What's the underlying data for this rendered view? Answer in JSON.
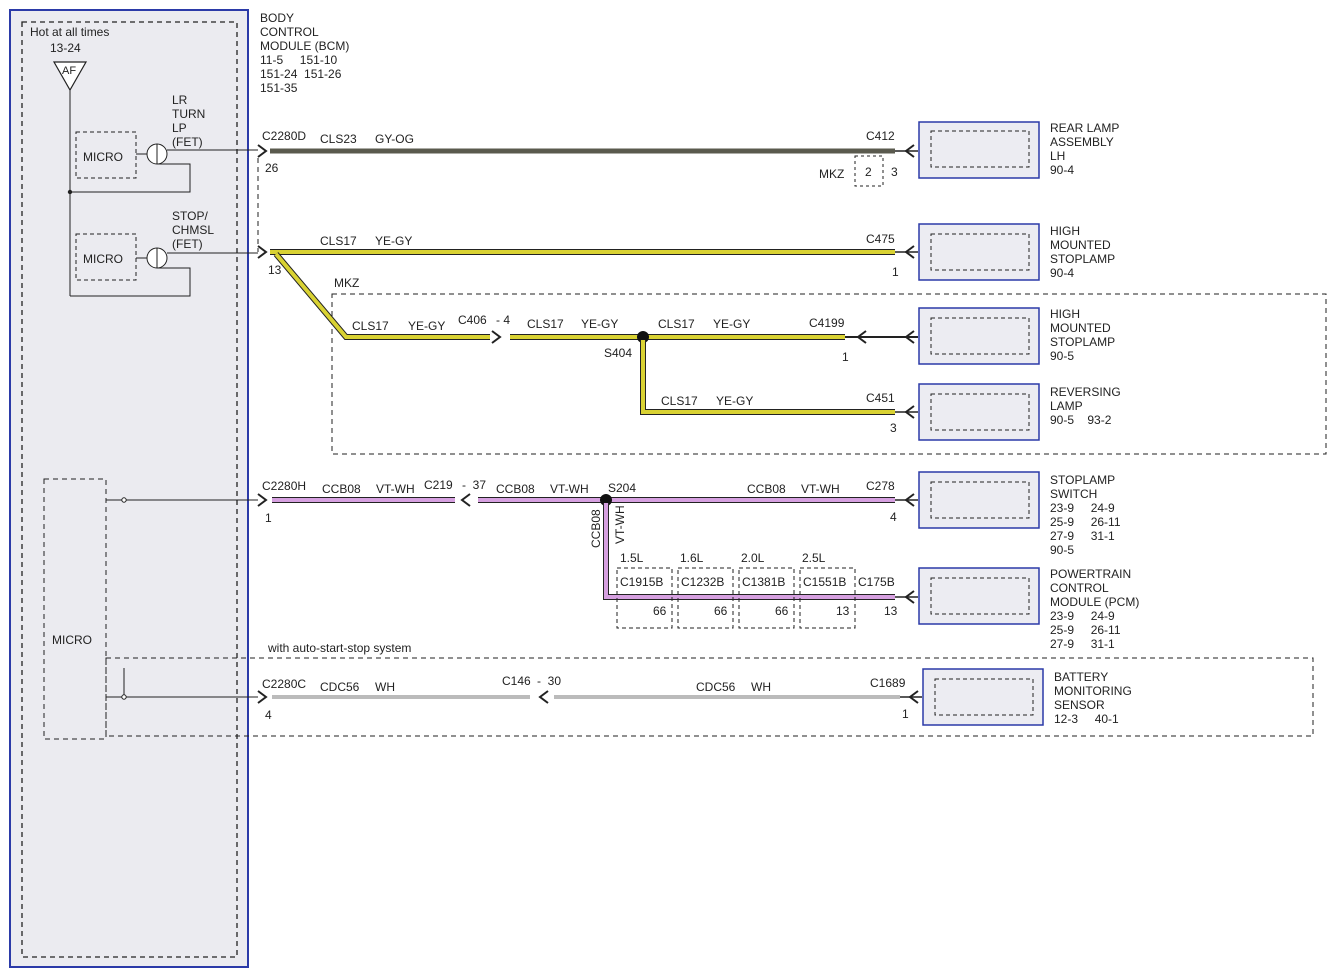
{
  "bcm": {
    "hot_label": "Hot at all times",
    "fuse_ref": "13-24",
    "fuse_label": "AF",
    "title_lines": [
      "BODY",
      "CONTROL",
      "MODULE (BCM)"
    ],
    "ref_lines": [
      "11-5     151-10",
      "151-24  151-26",
      "151-35"
    ],
    "micro_label": "MICRO",
    "lr_turn_lines": [
      "LR",
      "TURN",
      "LP",
      "(FET)"
    ],
    "stop_lines": [
      "STOP/",
      "CHMSL",
      "(FET)"
    ]
  },
  "circuits": {
    "c2280d": {
      "connector": "C2280D",
      "pin": "26",
      "wire": "CLS23",
      "color_code": "GY-OG",
      "color": "#5a5a4e"
    },
    "c2280d_end": {
      "connector": "C412",
      "pin": "3",
      "mkz": "MKZ",
      "mkz_pin": "2"
    },
    "stop": {
      "pin": "13",
      "wire": "CLS17",
      "color_code": "YE-GY",
      "connector_end": "C475",
      "pin_end": "1",
      "color": "#d9d233"
    },
    "mkz_label": "MKZ",
    "mkz_branch": {
      "wire": "CLS17",
      "color_code": "YE-GY",
      "c406": "C406",
      "c406_pin": "- 4",
      "splice": "S404",
      "c4199": "C4199",
      "c4199_pin": "1",
      "c451": "C451",
      "c451_pin": "3"
    },
    "c2280h": {
      "connector": "C2280H",
      "pin": "1",
      "wire": "CCB08",
      "color_code": "VT-WH",
      "color": "#d6a0e0",
      "c219": "C219",
      "c219_pin": "-  37",
      "splice": "S204",
      "c278": "C278",
      "c278_pin": "4",
      "c175b": "C175B",
      "c175b_pin": "13"
    },
    "pcm_options": [
      {
        "engine": "1.5L",
        "connector": "C1915B",
        "pin": "66"
      },
      {
        "engine": "1.6L",
        "connector": "C1232B",
        "pin": "66"
      },
      {
        "engine": "2.0L",
        "connector": "C1381B",
        "pin": "66"
      },
      {
        "engine": "2.5L",
        "connector": "C1551B",
        "pin": "13"
      }
    ],
    "auto_start_label": "with auto-start-stop system",
    "c2280c": {
      "connector": "C2280C",
      "pin": "4",
      "wire": "CDC56",
      "color_code": "WH",
      "c146": "C146",
      "c146_pin": "-  30",
      "c1689": "C1689",
      "c1689_pin": "1"
    }
  },
  "components": {
    "rear_lamp": {
      "lines": [
        "REAR LAMP",
        "ASSEMBLY",
        "LH"
      ],
      "ref": "90-4"
    },
    "hmsl1": {
      "lines": [
        "HIGH",
        "MOUNTED",
        "STOPLAMP"
      ],
      "ref": "90-4"
    },
    "hmsl2": {
      "lines": [
        "HIGH",
        "MOUNTED",
        "STOPLAMP"
      ],
      "ref": "90-5"
    },
    "reversing": {
      "lines": [
        "REVERSING",
        "LAMP"
      ],
      "ref": "90-5    93-2"
    },
    "stoplamp_switch": {
      "lines": [
        "STOPLAMP",
        "SWITCH"
      ],
      "refs": [
        "23-9     24-9",
        "25-9     26-11",
        "27-9     31-1",
        "90-5"
      ]
    },
    "pcm": {
      "lines": [
        "POWERTRAIN",
        "CONTROL",
        "MODULE (PCM)"
      ],
      "refs": [
        "23-9     24-9",
        "25-9     26-11",
        "27-9     31-1"
      ]
    },
    "bms": {
      "lines": [
        "BATTERY",
        "MONITORING",
        "SENSOR"
      ],
      "ref": "12-3     40-1"
    }
  },
  "colors": {
    "module_border": "#2b3aa8",
    "component_fill": "#ececf2",
    "yellow": "#d9d233",
    "violet": "#d6a0e0",
    "gray_og": "#5a5a4e",
    "white_wire": "#bbbbbb"
  }
}
